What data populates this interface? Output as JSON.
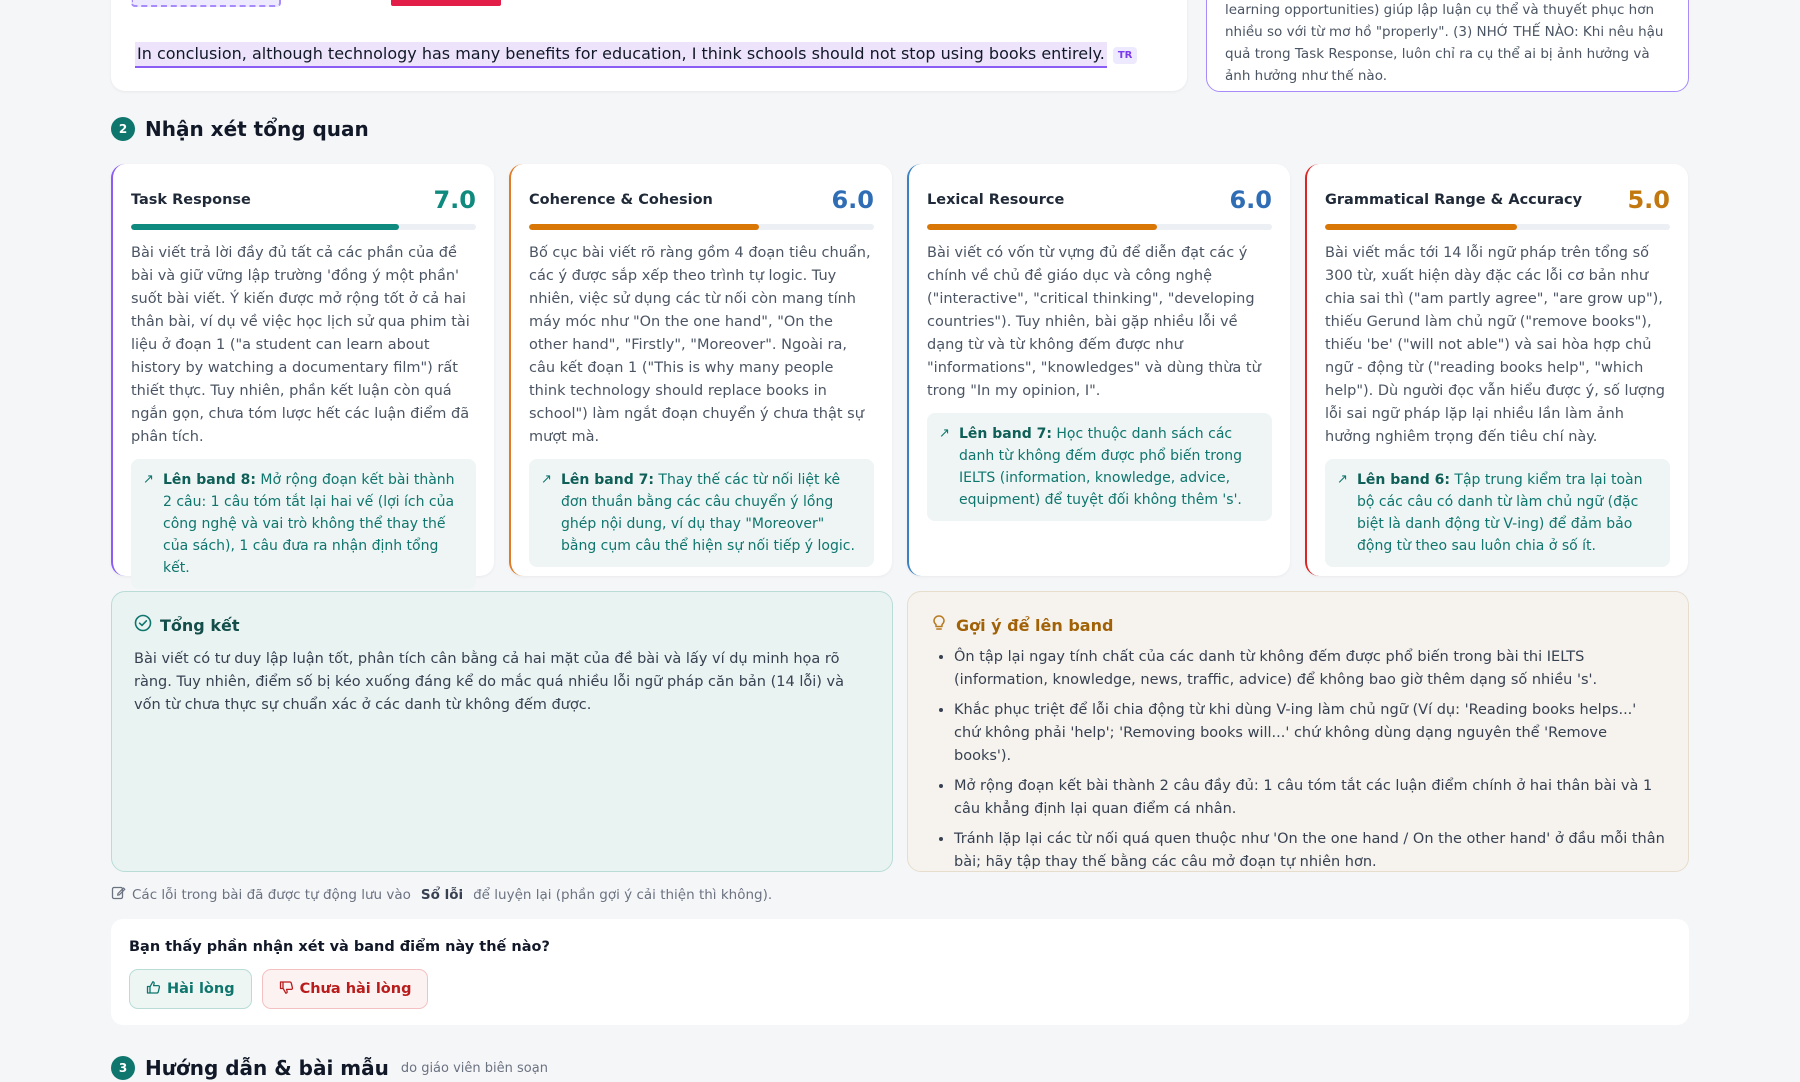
{
  "essay": {
    "conclusion_sentence": "In conclusion, although technology has many benefits for education, I think schools should not stop using books entirely.",
    "tag": "TR"
  },
  "tip_card": {
    "text": "learning opportunities) giúp lập luận cụ thể và thuyết phục hơn nhiều so với từ mơ hồ \"properly\". (3) NHỚ THẾ NÀO: Khi nêu hậu quả trong Task Response, luôn chỉ ra cụ thể ai bị ảnh hưởng và ảnh hưởng như thế nào."
  },
  "section2": {
    "number": "2",
    "title": "Nhận xét tổng quan"
  },
  "criteria": [
    {
      "name": "Task Response",
      "score": "7.0",
      "score_value": 7.0,
      "color": "#0f8a7e",
      "border": "#8b5cf6",
      "description": "Bài viết trả lời đầy đủ tất cả các phần của đề bài và giữ vững lập trường 'đồng ý một phần' suốt bài viết. Ý kiến được mở rộng tốt ở cả hai thân bài, ví dụ về việc học lịch sử qua phim tài liệu ở đoạn 1 (\"a student can learn about history by watching a documentary film\") rất thiết thực. Tuy nhiên, phần kết luận còn quá ngắn gọn, chưa tóm lược hết các luận điểm đã phân tích.",
      "improve_label": "Lên band 8:",
      "improve_text": " Mở rộng đoạn kết bài thành 2 câu: 1 câu tóm tắt lại hai vế (lợi ích của công nghệ và vai trò không thể thay thế của sách), 1 câu đưa ra nhận định tổng kết."
    },
    {
      "name": "Coherence & Cohesion",
      "score": "6.0",
      "score_value": 6.0,
      "color": "#2f6db5",
      "border": "#e07b28",
      "description": "Bố cục bài viết rõ ràng gồm 4 đoạn tiêu chuẩn, các ý được sắp xếp theo trình tự logic. Tuy nhiên, việc sử dụng các từ nối còn mang tính máy móc như \"On the one hand\", \"On the other hand\", \"Firstly\", \"Moreover\". Ngoài ra, câu kết đoạn 1 (\"This is why many people think technology should replace books in school\") làm ngắt đoạn chuyển ý chưa thật sự mượt mà.",
      "improve_label": "Lên band 7:",
      "improve_text": " Thay thế các từ nối liệt kê đơn thuần bằng các câu chuyển ý lồng ghép nội dung, ví dụ thay \"Moreover\" bằng cụm câu thể hiện sự nối tiếp ý logic."
    },
    {
      "name": "Lexical Resource",
      "score": "6.0",
      "score_value": 6.0,
      "color": "#2f6db5",
      "border": "#3b82c4",
      "description": "Bài viết có vốn từ vựng đủ để diễn đạt các ý chính về chủ đề giáo dục và công nghệ (\"interactive\", \"critical thinking\", \"developing countries\"). Tuy nhiên, bài gặp nhiều lỗi về dạng từ và từ không đếm được như \"informations\", \"knowledges\" và dùng thừa từ trong \"In my opinion, I\".",
      "improve_label": "Lên band 7:",
      "improve_text": " Học thuộc danh sách các danh từ không đếm được phổ biến trong IELTS (information, knowledge, advice, equipment) để tuyệt đối không thêm 's'."
    },
    {
      "name": "Grammatical Range & Accuracy",
      "score": "5.0",
      "score_value": 5.0,
      "color": "#c2780f",
      "border": "#dc2626",
      "description": "Bài viết mắc tới 14 lỗi ngữ pháp trên tổng số 300 từ, xuất hiện dày đặc các lỗi cơ bản như chia sai thì (\"am partly agree\", \"are grow up\"), thiếu Gerund làm chủ ngữ (\"remove books\"), thiếu 'be' (\"will not able\") và sai hòa hợp chủ ngữ - động từ (\"reading books help\", \"which help\"). Dù người đọc vẫn hiểu được ý, số lượng lỗi sai ngữ pháp lặp lại nhiều lần làm ảnh hưởng nghiêm trọng đến tiêu chí này.",
      "improve_label": "Lên band 6:",
      "improve_text": " Tập trung kiểm tra lại toàn bộ các câu có danh từ làm chủ ngữ (đặc biệt là danh động từ V-ing) để đảm bảo động từ theo sau luôn chia ở số ít."
    }
  ],
  "summary": {
    "title": "Tổng kết",
    "text": "Bài viết có tư duy lập luận tốt, phân tích cân bằng cả hai mặt của đề bài và lấy ví dụ minh họa rõ ràng. Tuy nhiên, điểm số bị kéo xuống đáng kể do mắc quá nhiều lỗi ngữ pháp căn bản (14 lỗi) và vốn từ chưa thực sự chuẩn xác ở các danh từ không đếm được."
  },
  "suggestions": {
    "title": "Gợi ý để lên band",
    "items": [
      "Ôn tập lại ngay tính chất của các danh từ không đếm được phổ biến trong bài thi IELTS (information, knowledge, news, traffic, advice) để không bao giờ thêm dạng số nhiều 's'.",
      "Khắc phục triệt để lỗi chia động từ khi dùng V-ing làm chủ ngữ (Ví dụ: 'Reading books helps...' chứ không phải 'help'; 'Removing books will...' chứ không dùng dạng nguyên thể 'Remove books').",
      "Mở rộng đoạn kết bài thành 2 câu đầy đủ: 1 câu tóm tắt các luận điểm chính ở hai thân bài và 1 câu khẳng định lại quan điểm cá nhân.",
      "Tránh lặp lại các từ nối quá quen thuộc như 'On the one hand / On the other hand' ở đầu mỗi thân bài; hãy tập thay thế bằng các câu mở đoạn tự nhiên hơn."
    ]
  },
  "note": {
    "before": "Các lỗi trong bài đã được tự động lưu vào",
    "link": "Sổ lỗi",
    "after": "để luyện lại (phần gợi ý cải thiện thì không)."
  },
  "feedback": {
    "question": "Bạn thấy phần nhận xét và band điểm này thế nào?",
    "yes": "Hài lòng",
    "no": "Chưa hài lòng"
  },
  "section3": {
    "number": "3",
    "title": "Hướng dẫn & bài mẫu",
    "subtitle": "do giáo viên biên soạn"
  }
}
